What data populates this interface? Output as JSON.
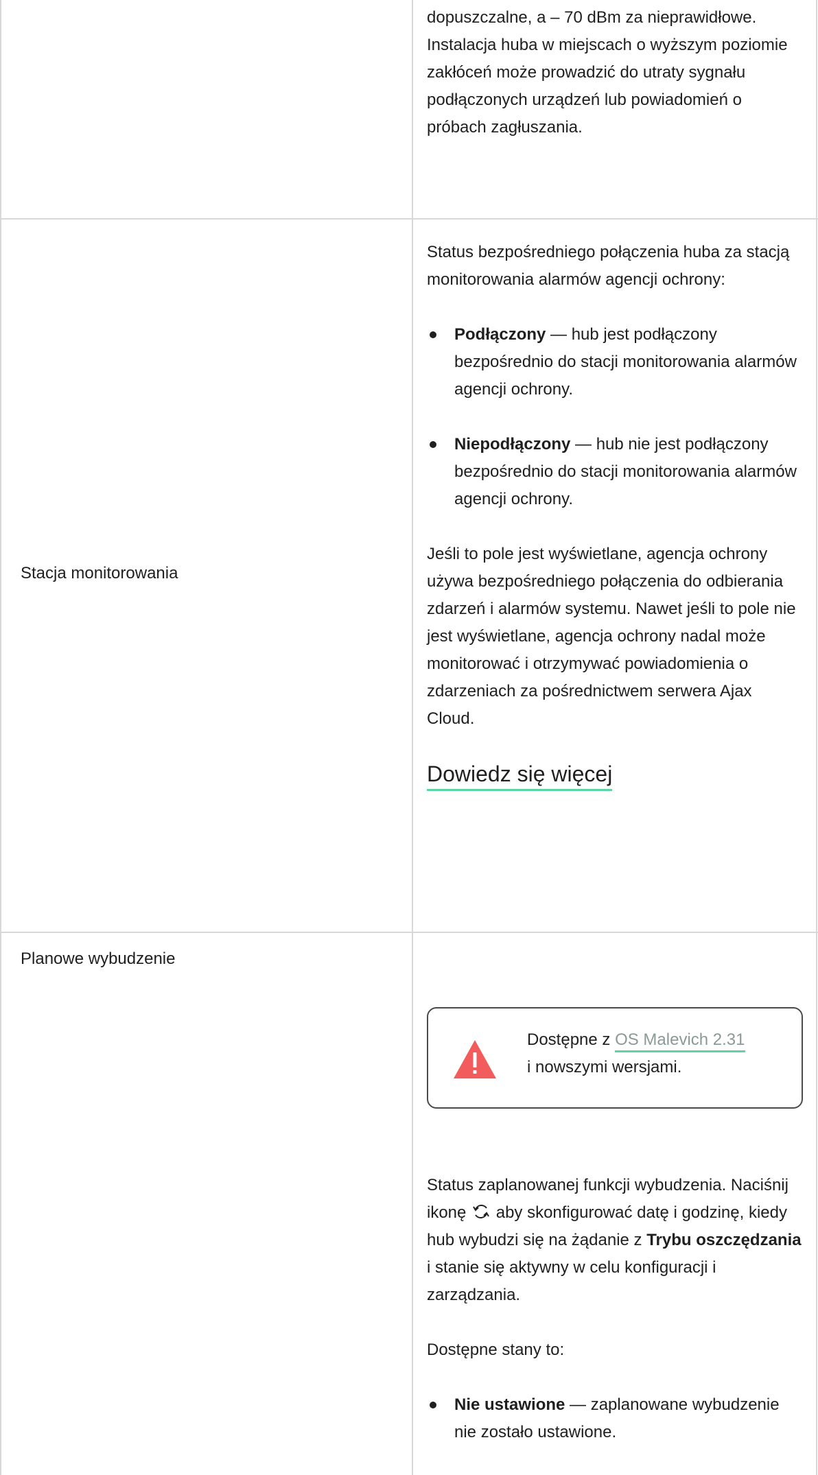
{
  "row1": {
    "content": "dopuszczalne, a – 70 dBm za nieprawidłowe. Instalacja huba w miejscach o wyższym poziomie zakłóceń może prowadzić do utraty sygnału podłączonych urządzeń lub powiadomień o próbach zagłuszania."
  },
  "row2": {
    "label": "Stacja monitorowania",
    "intro": "Status bezpośredniego połączenia huba za stacją monitorowania alarmów agencji ochrony:",
    "bullets": [
      {
        "term": "Podłączony",
        "text": " — hub jest podłączony bezpośrednio do stacji monitorowania alarmów agencji ochrony."
      },
      {
        "term": "Niepodłączony",
        "text": " — hub nie jest podłączony bezpośrednio do stacji monitorowania alarmów agencji ochrony."
      }
    ],
    "note": "Jeśli to pole jest wyświetlane, agencja ochrony używa bezpośredniego połączenia do odbierania zdarzeń i alarmów systemu. Nawet jeśli to pole nie jest wyświetlane, agencja ochrony nadal może monitorować i otrzymywać powiadomienia o zdarzeniach za pośrednictwem serwera Ajax Cloud.",
    "learn_more": "Dowiedz się więcej"
  },
  "row3": {
    "label": "Planowe wybudzenie",
    "warning": {
      "prefix": "Dostępne z ",
      "link": "OS Malevich 2.31",
      "suffix": " i nowszymi wersjami."
    },
    "status_part1": "Status zaplanowanej funkcji wybudzenia. Naciśnij ikonę",
    "status_part2": " aby skonfigurować datę i godzinę, kiedy hub wybudzi się na żądanie z ",
    "status_bold": "Trybu oszczędzania",
    "status_part3": " i stanie się aktywny w celu konfiguracji i zarządzania.",
    "states_intro": "Dostępne stany to:",
    "bullets": [
      {
        "term": "Nie ustawione",
        "text": " — zaplanowane wybudzenie nie zostało ustawione."
      }
    ]
  },
  "colors": {
    "accent": "#5ed3a3",
    "warning": "#f25c5c",
    "border": "#d8d8d8"
  }
}
